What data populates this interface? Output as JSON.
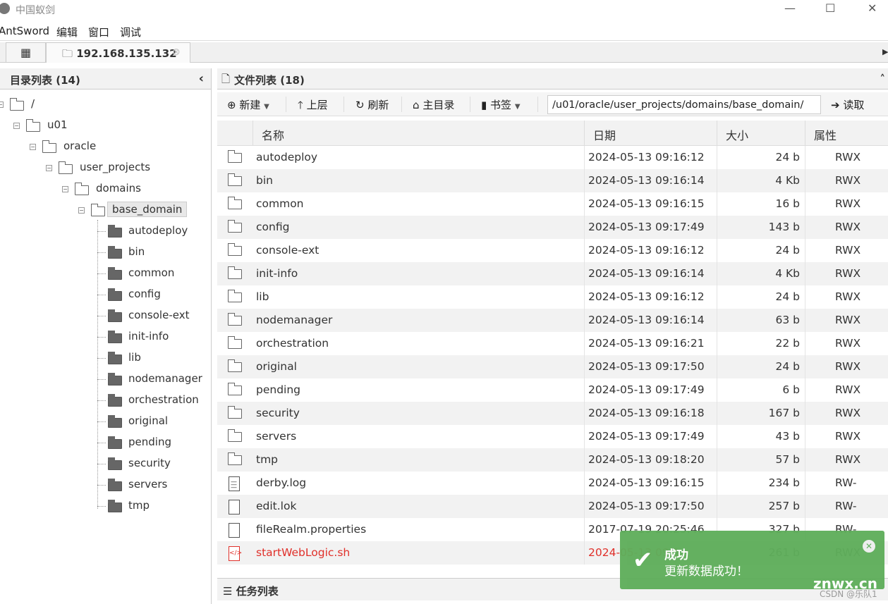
{
  "window": {
    "title": "中国蚁剑",
    "minimize": "—",
    "maximize": "☐"
  },
  "menu": [
    "AntSword",
    "编辑",
    "窗口",
    "调试"
  ],
  "tabs": {
    "home_icon": "grid-icon",
    "active": "192.168.135.132"
  },
  "left_panel": {
    "title": "目录列表 (14)",
    "collapse": "‹",
    "tree": [
      {
        "label": "/",
        "level": 0
      },
      {
        "label": "u01",
        "level": 1
      },
      {
        "label": "oracle",
        "level": 2
      },
      {
        "label": "user_projects",
        "level": 3
      },
      {
        "label": "domains",
        "level": 4
      },
      {
        "label": "base_domain",
        "level": 5,
        "selected": true
      }
    ],
    "children": [
      "autodeploy",
      "bin",
      "common",
      "config",
      "console-ext",
      "init-info",
      "lib",
      "nodemanager",
      "orchestration",
      "original",
      "pending",
      "security",
      "servers",
      "tmp"
    ]
  },
  "right_panel": {
    "title": "文件列表 (18)",
    "collapse": "˄",
    "toolbar": {
      "new": "新建",
      "up": "上层",
      "refresh": "刷新",
      "home": "主目录",
      "bookmark": "书签",
      "path": "/u01/oracle/user_projects/domains/base_domain/",
      "read": "读取"
    },
    "columns": [
      "名称",
      "日期",
      "大小",
      "属性"
    ],
    "files": [
      {
        "name": "autodeploy",
        "date": "2024-05-13 09:16:12",
        "size": "24 b",
        "attr": "RWX",
        "type": "folder"
      },
      {
        "name": "bin",
        "date": "2024-05-13 09:16:14",
        "size": "4 Kb",
        "attr": "RWX",
        "type": "folder"
      },
      {
        "name": "common",
        "date": "2024-05-13 09:16:15",
        "size": "16 b",
        "attr": "RWX",
        "type": "folder"
      },
      {
        "name": "config",
        "date": "2024-05-13 09:17:49",
        "size": "143 b",
        "attr": "RWX",
        "type": "folder"
      },
      {
        "name": "console-ext",
        "date": "2024-05-13 09:16:12",
        "size": "24 b",
        "attr": "RWX",
        "type": "folder"
      },
      {
        "name": "init-info",
        "date": "2024-05-13 09:16:14",
        "size": "4 Kb",
        "attr": "RWX",
        "type": "folder"
      },
      {
        "name": "lib",
        "date": "2024-05-13 09:16:12",
        "size": "24 b",
        "attr": "RWX",
        "type": "folder"
      },
      {
        "name": "nodemanager",
        "date": "2024-05-13 09:16:14",
        "size": "63 b",
        "attr": "RWX",
        "type": "folder"
      },
      {
        "name": "orchestration",
        "date": "2024-05-13 09:16:21",
        "size": "22 b",
        "attr": "RWX",
        "type": "folder"
      },
      {
        "name": "original",
        "date": "2024-05-13 09:17:50",
        "size": "24 b",
        "attr": "RWX",
        "type": "folder"
      },
      {
        "name": "pending",
        "date": "2024-05-13 09:17:49",
        "size": "6 b",
        "attr": "RWX",
        "type": "folder"
      },
      {
        "name": "security",
        "date": "2024-05-13 09:16:18",
        "size": "167 b",
        "attr": "RWX",
        "type": "folder"
      },
      {
        "name": "servers",
        "date": "2024-05-13 09:17:49",
        "size": "43 b",
        "attr": "RWX",
        "type": "folder"
      },
      {
        "name": "tmp",
        "date": "2024-05-13 09:18:20",
        "size": "57 b",
        "attr": "RWX",
        "type": "folder"
      },
      {
        "name": "derby.log",
        "date": "2024-05-13 09:16:15",
        "size": "234 b",
        "attr": "RW-",
        "type": "text"
      },
      {
        "name": "edit.lok",
        "date": "2024-05-13 09:17:50",
        "size": "257 b",
        "attr": "RW-",
        "type": "file"
      },
      {
        "name": "fileRealm.properties",
        "date": "2017-07-19 20:25:46",
        "size": "327 b",
        "attr": "RW-",
        "type": "file"
      },
      {
        "name": "startWebLogic.sh",
        "date": "2024-05-13 09:1",
        "size": "261 b",
        "attr": "RWX",
        "type": "script",
        "color": "#e0302a"
      }
    ]
  },
  "task_panel": {
    "title": "任务列表"
  },
  "toast": {
    "title": "成功",
    "message": "更新数据成功！",
    "color": "#5fae5b"
  },
  "watermark": {
    "site": "znwx.cn",
    "credit": "CSDN @乐队1"
  }
}
